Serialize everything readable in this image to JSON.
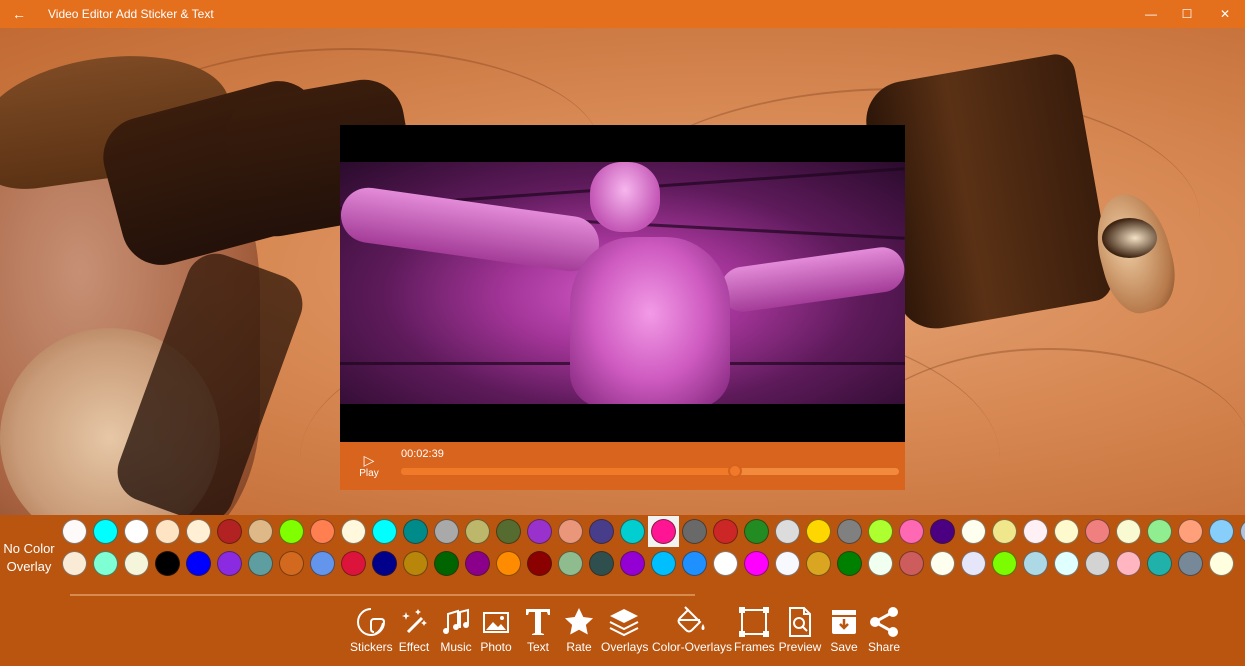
{
  "window": {
    "title": "Video Editor Add Sticker & Text",
    "back_glyph": "←",
    "minimize_glyph": "—",
    "maximize_glyph": "☐",
    "close_glyph": "✕"
  },
  "player": {
    "play_label": "Play",
    "play_glyph": "▷",
    "timecode": "00:02:39",
    "progress": 0.67
  },
  "overlay": {
    "no_color_label": "No Color Overlay",
    "selected_index": 19,
    "row1": [
      "#fffafa",
      "#00ffff",
      "#ffffff",
      "#ffe4c4",
      "#ffefd5",
      "#b22222",
      "#deb887",
      "#7fff00",
      "#ff7f50",
      "#fff8dc",
      "#00ffff",
      "#008b8b",
      "#a9a9a9",
      "#bdb76b",
      "#556b2f",
      "#9932cc",
      "#e9967a",
      "#483d8b",
      "#00ced1",
      "#ff1493",
      "#696969",
      "#cd2626",
      "#228b22",
      "#dcdcdc",
      "#ffd700",
      "#808080",
      "#adff2f",
      "#ff69b4",
      "#4b0082",
      "#fffff0",
      "#f0e68c",
      "#fff0f5",
      "#fffacd",
      "#f08080",
      "#fafad2",
      "#90ee90",
      "#ffa07a",
      "#87cefa",
      "#b0c4de"
    ],
    "row2": [
      "#faebd7",
      "#7fffd4",
      "#f5f5dc",
      "#000000",
      "#0000ff",
      "#8a2be2",
      "#5f9ea0",
      "#d2691e",
      "#6495ed",
      "#dc143c",
      "#00008b",
      "#b8860b",
      "#006400",
      "#8b008b",
      "#ff8c00",
      "#8b0000",
      "#8fbc8f",
      "#2f4f4f",
      "#9400d3",
      "#00bfff",
      "#1e90ff",
      "#ffffff",
      "#ff00ff",
      "#f8f8ff",
      "#daa520",
      "#008000",
      "#f0fff0",
      "#cd5c5c",
      "#fffff0",
      "#e6e6fa",
      "#7cfc00",
      "#add8e6",
      "#e0ffff",
      "#d3d3d3",
      "#ffb6c1",
      "#20b2aa",
      "#778899",
      "#ffffe0"
    ]
  },
  "toolbar": {
    "items": [
      {
        "name": "stickers",
        "label": "Stickers",
        "icon": "sticker-icon"
      },
      {
        "name": "effect",
        "label": "Effect",
        "icon": "magic-wand-icon"
      },
      {
        "name": "music",
        "label": "Music",
        "icon": "music-notes-icon"
      },
      {
        "name": "photo",
        "label": "Photo",
        "icon": "photo-icon"
      },
      {
        "name": "text",
        "label": "Text",
        "icon": "text-t-icon"
      },
      {
        "name": "rate",
        "label": "Rate",
        "icon": "star-icon"
      },
      {
        "name": "overlays",
        "label": "Overlays",
        "icon": "layers-icon"
      },
      {
        "name": "color-overlays",
        "label": "Color-Overlays",
        "icon": "paint-bucket-icon"
      },
      {
        "name": "frames",
        "label": "Frames",
        "icon": "frame-icon"
      },
      {
        "name": "preview",
        "label": "Preview",
        "icon": "document-search-icon"
      },
      {
        "name": "save",
        "label": "Save",
        "icon": "save-download-icon"
      },
      {
        "name": "share",
        "label": "Share",
        "icon": "share-icon"
      }
    ]
  }
}
